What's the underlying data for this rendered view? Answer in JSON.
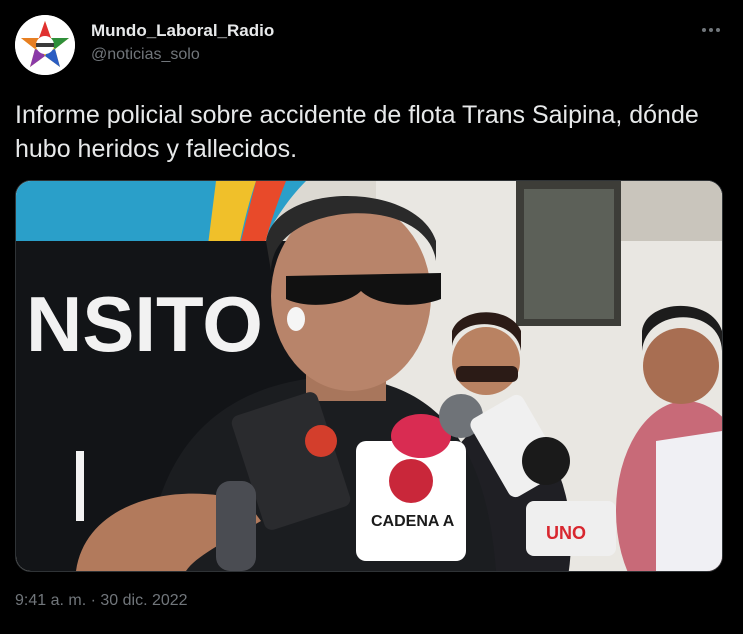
{
  "author": {
    "display_name": "Mundo_Laboral_Radio",
    "handle": "@noticias_solo",
    "avatar_icon": "star-logo-icon"
  },
  "more_icon": "more-dots-icon",
  "tweet": {
    "text": "Informe policial sobre accidente de flota Trans Saipina, dónde hubo heridos y fallecidos.",
    "time": "9:41 a. m.",
    "separator": "·",
    "date": "30 dic. 2022"
  },
  "media": {
    "kind": "video-thumbnail",
    "wall_sign_text": "NSITO",
    "mic_labels": [
      "CADENA A",
      "UNO"
    ]
  },
  "colors": {
    "background": "#000000",
    "text_primary": "#e7e9ea",
    "text_secondary": "#71767b",
    "border": "#2f3336"
  }
}
